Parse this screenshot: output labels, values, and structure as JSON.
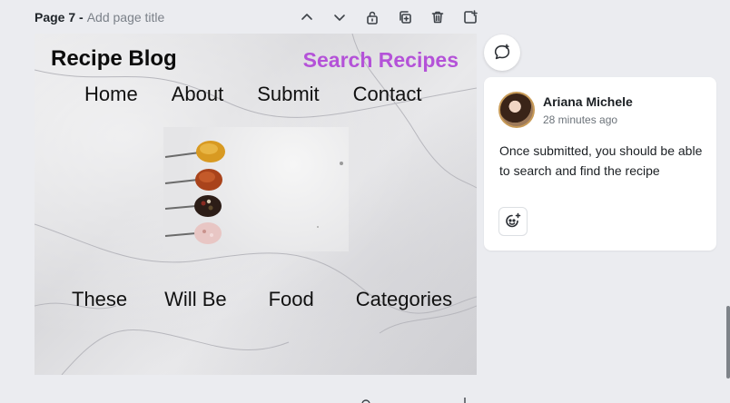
{
  "page": {
    "label": "Page 7 -",
    "title_placeholder": "Add page title"
  },
  "toolbar": {
    "icons": [
      "chevron-up-icon",
      "chevron-down-icon",
      "lock-icon",
      "duplicate-icon",
      "trash-icon",
      "add-page-icon"
    ]
  },
  "canvas": {
    "blog_title": "Recipe Blog",
    "search_link": "Search Recipes",
    "accent_color": "#b452d8",
    "nav": [
      "Home",
      "About",
      "Submit",
      "Contact"
    ],
    "categories": [
      "These",
      "Will Be",
      "Food",
      "Categories"
    ]
  },
  "comment": {
    "author": "Ariana Michele",
    "time": "28 minutes ago",
    "text": "Once submitted, you should be able to search and find the recipe"
  }
}
